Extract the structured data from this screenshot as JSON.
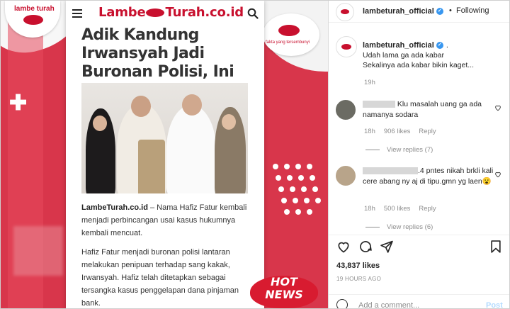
{
  "media": {
    "site_logo_left": "Lambe",
    "site_logo_right": "Turah.co.id",
    "left_logo_text": "lambe turah",
    "right_logo_tagline": "fakta yang tersembunyi",
    "article_title": "Adik Kandung Irwansyah Jadi Buronan Polisi, Ini Kasusnya",
    "paragraph1_source": "LambeTurah.co.id",
    "paragraph1": " – Nama Hafiz Fatur kembali menjadi perbincangan usai kasus hukumnya kembali mencuat.",
    "paragraph2": "Hafiz Fatur menjadi buronan polisi lantaran melakukan penipuan terhadap sang kakak, Irwansyah. Hafiz telah ditetapkan sebagai tersangka kasus penggelapan dana pinjaman bank.",
    "hot_line1": "HOT",
    "hot_line2": "NEWS",
    "accent_color": "#d8364b"
  },
  "header": {
    "username": "lambeturah_official",
    "separator": "•",
    "follow_status": "Following"
  },
  "caption": {
    "username": "lambeturah_official",
    "trailing": ".",
    "line1": "Udah lama ga ada kabar",
    "line2": "Sekalinya ada kabar bikin kaget...",
    "time": "19h"
  },
  "comments": [
    {
      "text": "Klu masalah uang ga ada namanya sodara",
      "time": "18h",
      "likes": "906 likes",
      "reply": "Reply",
      "view_replies": "View replies (7)"
    },
    {
      "text_visible": ".4 pntes nikah brkli kali cere abang ny aj di tipu.gmn yg laen",
      "emoji": "😮",
      "time": "18h",
      "likes": "500 likes",
      "reply": "Reply",
      "view_replies": "View replies (6)"
    }
  ],
  "icons": [
    "heart-icon",
    "comment-icon",
    "share-icon",
    "bookmark-icon",
    "emoji-icon",
    "verified-icon"
  ],
  "likes_count": "43,837 likes",
  "posted_ago": "19 HOURS AGO",
  "add_comment": {
    "placeholder": "Add a comment...",
    "post_label": "Post"
  }
}
